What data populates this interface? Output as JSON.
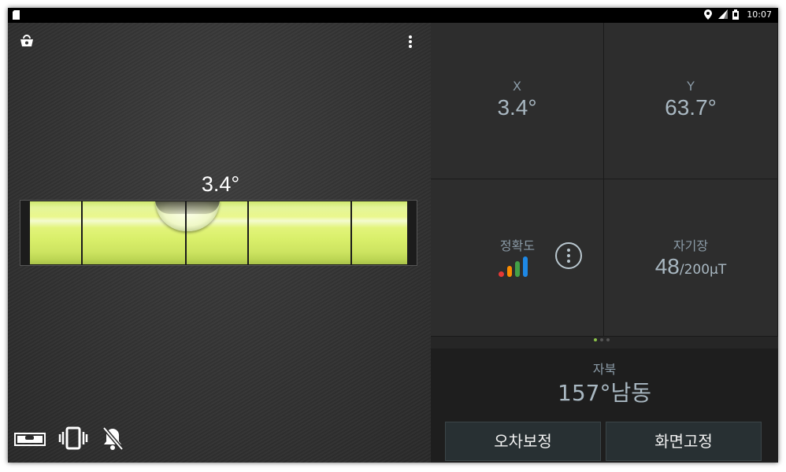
{
  "status_bar": {
    "time": "10:07",
    "icons": [
      "sd-card-icon",
      "location-icon",
      "signal-icon",
      "battery-icon"
    ]
  },
  "level": {
    "angle_display": "3.4°",
    "bubble_offset_fraction": 0.36
  },
  "toolbar": {
    "icons": [
      "shop-icon",
      "overflow-menu-icon"
    ]
  },
  "bottom_toolbar": {
    "icons": [
      "level-mode-icon",
      "vibrate-icon",
      "sound-off-icon"
    ]
  },
  "sensors": {
    "x": {
      "label": "X",
      "value": "3.4°"
    },
    "y": {
      "label": "Y",
      "value": "63.7°"
    },
    "accuracy": {
      "label": "정확도",
      "bar_colors": [
        "#e53935",
        "#fb8c00",
        "#43a047",
        "#1e88e5"
      ]
    },
    "magnetic": {
      "label": "자기장",
      "value": "48",
      "unit": "/200μT"
    }
  },
  "pager": {
    "count": 3,
    "active": 0
  },
  "compass": {
    "label": "자북",
    "value": "157°남동"
  },
  "buttons": {
    "calibrate": "오차보정",
    "lock_screen": "화면고정"
  },
  "colors": {
    "accent_green": "#8bc34a",
    "liquid": "#d9ef6a"
  }
}
